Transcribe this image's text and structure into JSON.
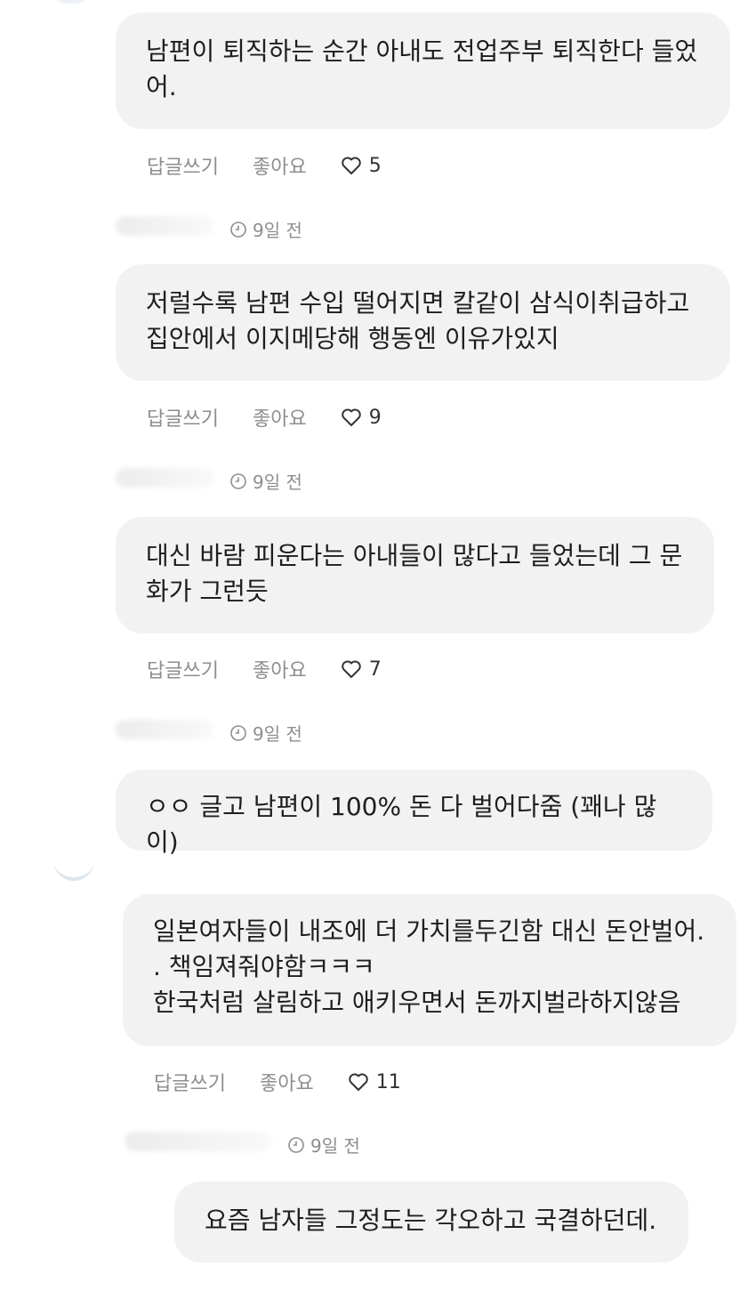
{
  "comments": [
    {
      "text": "남편이 퇴직하는 순간 아내도 전업주부 퇴직한다 들었\n어.",
      "reply_label": "답글쓰기",
      "like_label": "좋아요",
      "likes": "5",
      "time": "9일 전"
    },
    {
      "text": "저럴수록 남편 수입 떨어지면 칼같이 삼식이취급하고\n집안에서 이지메당해 행동엔 이유가있지",
      "reply_label": "답글쓰기",
      "like_label": "좋아요",
      "likes": "9",
      "time": "9일 전"
    },
    {
      "text": "대신 바람 피운다는 아내들이 많다고 들었는데 그 문\n화가 그런듯",
      "reply_label": "답글쓰기",
      "like_label": "좋아요",
      "likes": "7",
      "time": "9일 전"
    },
    {
      "text": "ㅇㅇ 글고 남편이 100% 돈 다 벌어다줌 (꽤나 많이)"
    },
    {
      "text": "일본여자들이 내조에 더 가치를두긴함 대신 돈안벌어.\n. 책임져줘야함ㅋㅋㅋ\n한국처럼 살림하고 애키우면서 돈까지벌라하지않음",
      "reply_label": "답글쓰기",
      "like_label": "좋아요",
      "likes": "11",
      "time": "9일 전"
    },
    {
      "text": "요즘 남자들 그정도는 각오하고 국결하던데."
    }
  ],
  "icons": {
    "heart": "heart-outline-icon",
    "clock": "clock-icon"
  },
  "colors": {
    "bubble_bg": "#f2f2f3",
    "meta_text": "#8e8e8e"
  }
}
